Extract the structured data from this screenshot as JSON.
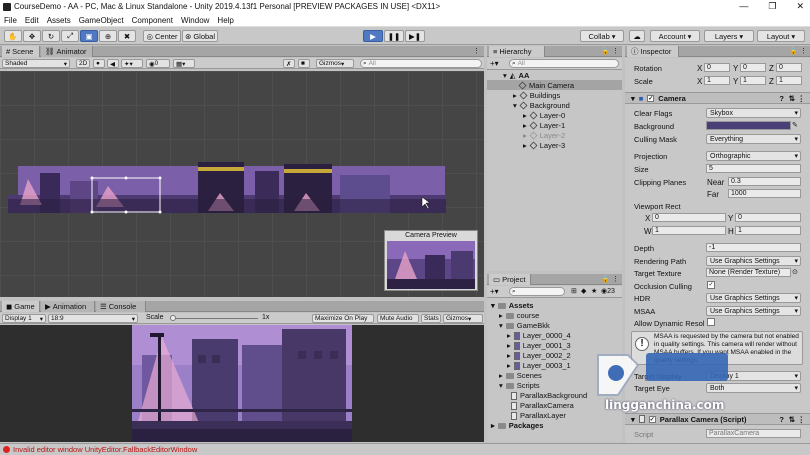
{
  "window": {
    "title": "CourseDemo - AA - PC, Mac & Linux Standalone - Unity 2019.4.13f1 Personal [PREVIEW PACKAGES IN USE] <DX11>"
  },
  "menu": [
    "File",
    "Edit",
    "Assets",
    "GameObject",
    "Component",
    "Window",
    "Help"
  ],
  "toolbar": {
    "center": "Center",
    "global": "Global",
    "collab": "Collab",
    "account": "Account",
    "layers": "Layers",
    "layout": "Layout"
  },
  "scene": {
    "tabs": [
      "Scene",
      "Animator"
    ],
    "shading": "Shaded",
    "mode2d": "2D",
    "gizmo_count": "0",
    "gizmos": "Gizmos",
    "search_placeholder": "All",
    "camera_preview_title": "Camera Preview"
  },
  "game": {
    "tabs": [
      "Game",
      "Animation",
      "Console"
    ],
    "display": "Display 1",
    "aspect": "18:9",
    "scale_label": "Scale",
    "scale_value": "1x",
    "buttons": [
      "Maximize On Play",
      "Mute Audio",
      "Stats",
      "Gizmos"
    ]
  },
  "hierarchy": {
    "tab": "Hierarchy",
    "search_placeholder": "All",
    "items": [
      {
        "label": "AA",
        "depth": 0
      },
      {
        "label": "Main Camera",
        "depth": 1,
        "selected": true
      },
      {
        "label": "Buildings",
        "depth": 1
      },
      {
        "label": "Background",
        "depth": 1
      },
      {
        "label": "Layer-0",
        "depth": 2
      },
      {
        "label": "Layer-1",
        "depth": 2
      },
      {
        "label": "Layer-2",
        "depth": 2,
        "disabled": true
      },
      {
        "label": "Layer-3",
        "depth": 2
      }
    ]
  },
  "project": {
    "tab": "Project",
    "count": "23",
    "items": [
      {
        "label": "Assets",
        "depth": 0,
        "type": "folder",
        "bold": true
      },
      {
        "label": "course",
        "depth": 1,
        "type": "folder"
      },
      {
        "label": "GameBkk",
        "depth": 1,
        "type": "folder"
      },
      {
        "label": "Layer_0000_4",
        "depth": 2,
        "type": "sprite"
      },
      {
        "label": "Layer_0001_3",
        "depth": 2,
        "type": "sprite"
      },
      {
        "label": "Layer_0002_2",
        "depth": 2,
        "type": "sprite"
      },
      {
        "label": "Layer_0003_1",
        "depth": 2,
        "type": "sprite"
      },
      {
        "label": "Scenes",
        "depth": 1,
        "type": "folder"
      },
      {
        "label": "Scripts",
        "depth": 1,
        "type": "folder"
      },
      {
        "label": "ParallaxBackground",
        "depth": 2,
        "type": "script"
      },
      {
        "label": "ParallaxCamera",
        "depth": 2,
        "type": "script"
      },
      {
        "label": "ParallaxLayer",
        "depth": 2,
        "type": "script"
      },
      {
        "label": "Packages",
        "depth": 0,
        "type": "folder",
        "bold": true
      }
    ]
  },
  "inspector": {
    "tab": "Inspector",
    "rotation": {
      "label": "Rotation",
      "x": "0",
      "y": "0",
      "z": "0"
    },
    "scale": {
      "label": "Scale",
      "x": "1",
      "y": "1",
      "z": "1"
    },
    "camera_title": "Camera",
    "clear_flags": {
      "label": "Clear Flags",
      "value": "Skybox"
    },
    "background": {
      "label": "Background",
      "color": "#4a3f77"
    },
    "culling_mask": {
      "label": "Culling Mask",
      "value": "Everything"
    },
    "projection": {
      "label": "Projection",
      "value": "Orthographic"
    },
    "size": {
      "label": "Size",
      "value": "5"
    },
    "clipping": {
      "label": "Clipping Planes",
      "near_label": "Near",
      "near": "0.3",
      "far_label": "Far",
      "far": "1000"
    },
    "viewport": {
      "label": "Viewport Rect",
      "x": "0",
      "y": "0",
      "w": "1",
      "h": "1"
    },
    "depth": {
      "label": "Depth",
      "value": "-1"
    },
    "rendering_path": {
      "label": "Rendering Path",
      "value": "Use Graphics Settings"
    },
    "target_texture": {
      "label": "Target Texture",
      "value": "None (Render Texture)"
    },
    "occlusion": {
      "label": "Occlusion Culling"
    },
    "hdr": {
      "label": "HDR",
      "value": "Use Graphics Settings"
    },
    "msaa": {
      "label": "MSAA",
      "value": "Use Graphics Settings"
    },
    "dynamic_res": {
      "label": "Allow Dynamic Resol"
    },
    "warning": "MSAA is requested by the camera but not enabled in quality settings. This camera will render without MSAA buffers. If you want MSAA enabled in the quality settings.",
    "target_display": {
      "label": "Target Display",
      "value": "Display 1"
    },
    "target_eye": {
      "label": "Target Eye",
      "value": "Both"
    },
    "parallax_title": "Parallax Camera (Script)",
    "script": {
      "label": "Script",
      "value": "ParallaxCamera"
    }
  },
  "status": {
    "message": "Invalid editor window UnityEditor.FallbackEditorWindow"
  },
  "watermark": {
    "text": "lingganchina.com"
  }
}
